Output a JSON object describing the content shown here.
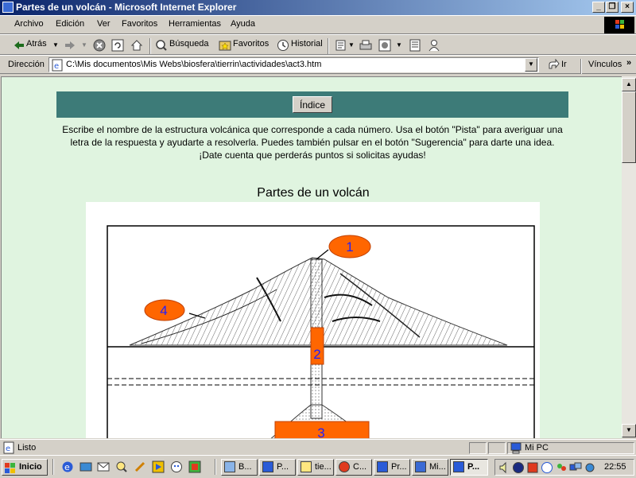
{
  "window": {
    "title": "Partes de un volcán - Microsoft Internet Explorer",
    "buttons": {
      "minimize": "_",
      "maximize": "❐",
      "close": "×"
    }
  },
  "menu": [
    "Archivo",
    "Edición",
    "Ver",
    "Favoritos",
    "Herramientas",
    "Ayuda"
  ],
  "toolbar": {
    "back": "Atrás",
    "search": "Búsqueda",
    "favorites": "Favoritos",
    "history": "Historial"
  },
  "addressbar": {
    "label": "Dirección",
    "url": "C:\\Mis documentos\\Mis Webs\\biosfera\\tierrin\\actividades\\act3.htm",
    "go": "Ir",
    "links": "Vínculos"
  },
  "page": {
    "index_button": "Índice",
    "instructions": "Escribe el nombre de la estructura volcánica que corresponde a cada número. Usa el botón \"Pista\" para averiguar una letra de la respuesta y ayudarte a resolverla. Puedes también pulsar en el botón \"Sugerencia\" para darte una idea. ¡Date cuenta que perderás puntos si solicitas ayudas!",
    "title": "Partes de un volcán",
    "labels": [
      "1",
      "2",
      "3",
      "4"
    ],
    "colors": {
      "label_fill": "#ff6600",
      "label_text": "#2020ff",
      "band": "#3d7b78",
      "background": "#e0f4e0"
    }
  },
  "statusbar": {
    "text": "Listo",
    "zone": "Mi PC"
  },
  "taskbar": {
    "start": "Inicio",
    "tasks": [
      "B...",
      "P...",
      "tie...",
      "C...",
      "Pr...",
      "Mi...",
      "P..."
    ],
    "clock": "22:55"
  }
}
